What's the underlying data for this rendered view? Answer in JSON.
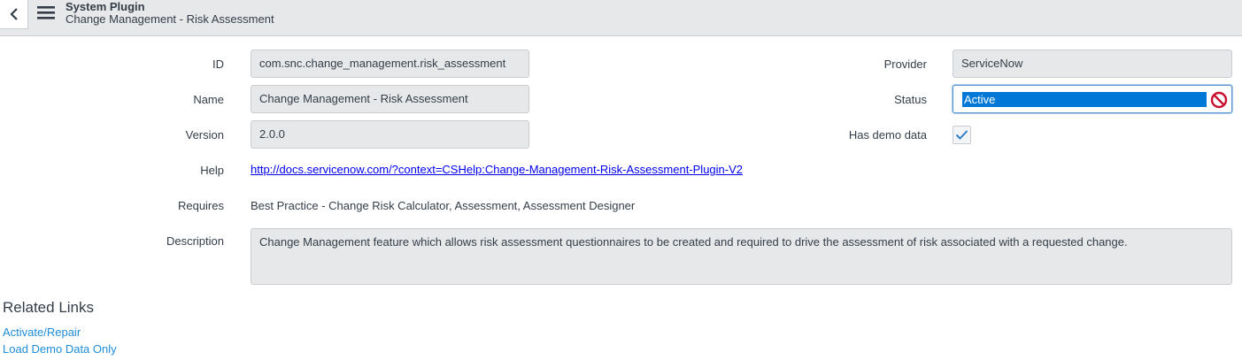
{
  "header": {
    "title": "System Plugin",
    "subtitle": "Change Management - Risk Assessment"
  },
  "form": {
    "id_label": "ID",
    "id_value": "com.snc.change_management.risk_assessment",
    "name_label": "Name",
    "name_value": "Change Management - Risk Assessment",
    "version_label": "Version",
    "version_value": "2.0.0",
    "help_label": "Help",
    "help_url": "http://docs.servicenow.com/?context=CSHelp:Change-Management-Risk-Assessment-Plugin-V2",
    "requires_label": "Requires",
    "requires_value": "Best Practice - Change Risk Calculator, Assessment, Assessment Designer",
    "description_label": "Description",
    "description_value": "Change Management feature which allows risk assessment questionnaires to be created and required to drive the assessment of risk associated with a requested change.",
    "provider_label": "Provider",
    "provider_value": "ServiceNow",
    "status_label": "Status",
    "status_value": "Active",
    "demo_label": "Has demo data",
    "demo_checked": true
  },
  "related": {
    "title": "Related Links",
    "links": [
      "Activate/Repair",
      "Load Demo Data Only"
    ]
  },
  "colors": {
    "link": "#1f8dd6",
    "help_link": "#0000ee",
    "selection": "#0078d7",
    "status_icon": "#c8102e",
    "checkmark": "#2e7dc9"
  },
  "icons": {
    "back": "chevron-left-icon",
    "menu": "hamburger-menu-icon",
    "status_indicator": "prohibited-icon",
    "checkbox": "checkmark-icon"
  }
}
